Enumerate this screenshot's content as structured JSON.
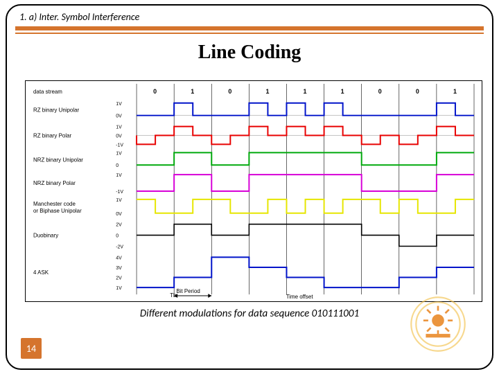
{
  "header": {
    "section": "1. a) Inter. Symbol Interference"
  },
  "title": "Line Coding",
  "caption": "Different modulations for data sequence 010111001",
  "page_number": "14",
  "chart_data": {
    "type": "line",
    "bits": [
      "0",
      "1",
      "0",
      "1",
      "1",
      "1",
      "0",
      "0",
      "1"
    ],
    "x_axis_label": "Time offset",
    "bit_period_label": "Bit Period",
    "trace_colors": {
      "rz_unipolar": "#0013c9",
      "rz_polar": "#e80000",
      "nrz_unipolar": "#00a90c",
      "nrz_polar": "#d700d7",
      "manchester": "#e6e600",
      "duobinary": "#000000",
      "ask4": "#0013c9"
    },
    "rows": [
      {
        "name": "data stream",
        "levels": []
      },
      {
        "name": "RZ binary Unipolar",
        "levels": [
          "1V",
          "0V"
        ]
      },
      {
        "name": "RZ binary Polar",
        "levels": [
          "1V",
          "0V",
          "-1V"
        ]
      },
      {
        "name": "NRZ binary Unipolar",
        "levels": [
          "1V",
          "0"
        ]
      },
      {
        "name": "NRZ binary Polar",
        "levels": [
          "1V",
          "-1V"
        ]
      },
      {
        "name": "Manchester code or Biphase Unipolar",
        "levels": [
          "1V",
          "0V"
        ]
      },
      {
        "name": "Duobinary",
        "levels": [
          "2V",
          "0",
          "-2V"
        ]
      },
      {
        "name": "4 ASK",
        "levels": [
          "4V",
          "3V",
          "2V",
          "1V"
        ]
      }
    ],
    "series_by_bit": {
      "rz_unipolar": {
        "0": 0,
        "1": "pulse_high_half"
      },
      "rz_polar": {
        "0": "pulse_low_half",
        "1": "pulse_high_half"
      },
      "nrz_unipolar": {
        "0": 0,
        "1": 1
      },
      "nrz_polar": {
        "0": -1,
        "1": 1
      },
      "manchester": {
        "0": "hi_lo",
        "1": "lo_hi"
      }
    },
    "duobinary_levels": [
      0,
      1,
      0,
      1,
      1,
      1,
      0,
      -1,
      0
    ],
    "ask4_levels": [
      1,
      2,
      4,
      3,
      2,
      1,
      1,
      2,
      3
    ]
  }
}
